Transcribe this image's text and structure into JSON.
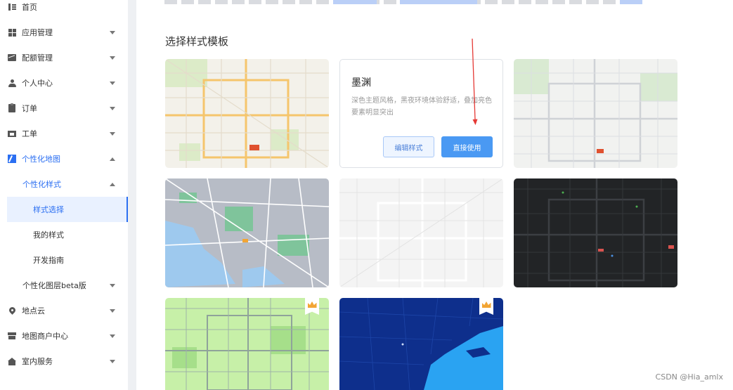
{
  "sidebar": {
    "items": [
      {
        "label": "首页"
      },
      {
        "label": "应用管理"
      },
      {
        "label": "配额管理"
      },
      {
        "label": "个人中心"
      },
      {
        "label": "订单"
      },
      {
        "label": "工单"
      },
      {
        "label": "个性化地图"
      },
      {
        "label": "个性化样式"
      },
      {
        "label": "样式选择"
      },
      {
        "label": "我的样式"
      },
      {
        "label": "开发指南"
      },
      {
        "label": "个性化图层beta版"
      },
      {
        "label": "地点云"
      },
      {
        "label": "地图商户中心"
      },
      {
        "label": "室内服务"
      }
    ],
    "icons": [
      "list-icon",
      "grid-icon",
      "chart-icon",
      "user-icon",
      "clipboard-icon",
      "ticket-icon",
      "map-icon",
      "pin-icon",
      "shop-icon",
      "indoor-icon"
    ]
  },
  "main": {
    "section_title": "选择样式模板",
    "detail_card": {
      "title": "墨渊",
      "description": "深色主题风格，黑夜环境体验舒适，叠加亮色要素明显突出",
      "edit_label": "编辑样式",
      "use_label": "直接使用"
    }
  },
  "colors": {
    "accent": "#2b6ff2",
    "primary_button": "#4a99f3",
    "annotation_arrow": "#e53935",
    "crown": "#f2a534"
  },
  "watermark": "CSDN @Hia_amlx"
}
